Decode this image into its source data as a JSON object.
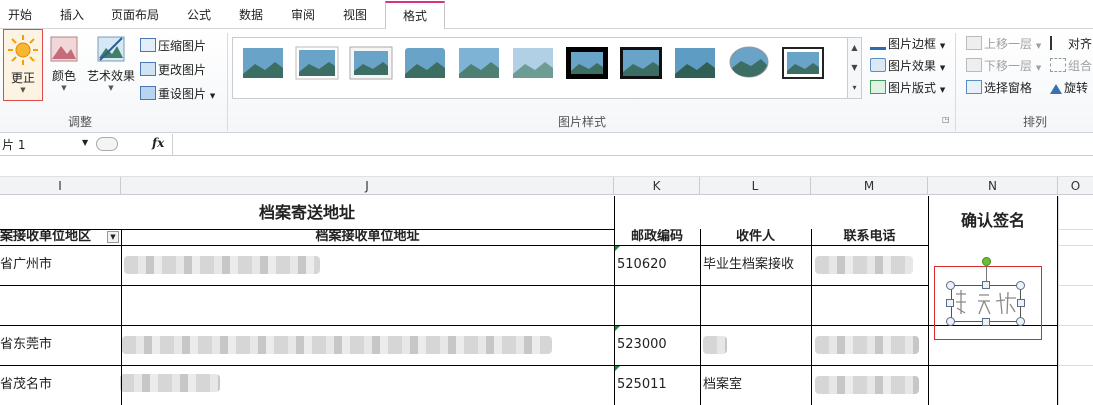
{
  "tabs": [
    "开始",
    "插入",
    "页面布局",
    "公式",
    "数据",
    "审阅",
    "视图",
    "格式"
  ],
  "ribbon": {
    "adjust": {
      "group_label": "调整",
      "correct": "更正",
      "color": "颜色",
      "artistic": "艺术效果",
      "compress": "压缩图片",
      "change": "更改图片",
      "reset": "重设图片"
    },
    "styles": {
      "group_label": "图片样式",
      "border": "图片边框",
      "effects": "图片效果",
      "layout": "图片版式"
    },
    "arrange": {
      "group_label": "排列",
      "bring_forward": "上移一层",
      "send_backward": "下移一层",
      "selection_pane": "选择窗格",
      "align": "对齐",
      "group": "组合",
      "rotate": "旋转"
    }
  },
  "formula_bar": {
    "name_box": "片 1",
    "fx": "fx",
    "formula": ""
  },
  "columns": [
    "I",
    "J",
    "K",
    "L",
    "M",
    "N",
    "O"
  ],
  "table": {
    "title": "档案寄送地址",
    "confirm_sign": "确认签名",
    "headers": [
      "案接收单位地区",
      "档案接收单位地址",
      "邮政编码",
      "收件人",
      "联系电话"
    ],
    "rows": [
      {
        "region": "省广州市",
        "postcode": "510620",
        "recipient": "毕业生档案接收"
      },
      {
        "region": "",
        "postcode": "",
        "recipient": ""
      },
      {
        "region": "省东莞市",
        "postcode": "523000",
        "recipient": ""
      },
      {
        "region": "省茂名市",
        "postcode": "525011",
        "recipient": "档案室"
      }
    ]
  },
  "colors": {
    "accent": "#d63384",
    "selection_red": "#d92b2b",
    "handle_green": "#6dbf3a"
  }
}
